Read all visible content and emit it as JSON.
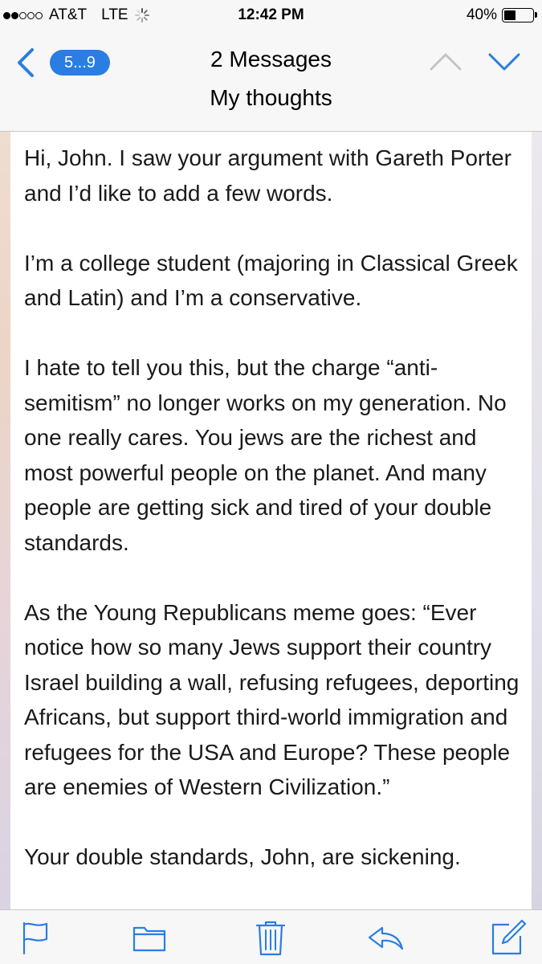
{
  "status_bar": {
    "carrier": "AT&T",
    "network": "LTE",
    "time": "12:42 PM",
    "battery_percent": "40%",
    "battery_level": 0.4,
    "signal_bars_filled": 2,
    "signal_bars_total": 5
  },
  "header": {
    "back_badge": "5...9",
    "title": "2 Messages",
    "subtitle": "My thoughts",
    "icons": {
      "back": "chevron-left-icon",
      "previous": "chevron-up-icon",
      "next": "chevron-down-icon"
    }
  },
  "message": {
    "paragraphs": [
      "Hi, John.  I saw your argument with Gareth Porter and I’d like to add a few words.",
      "I’m a college student (majoring in Classical Greek and Latin) and I’m a conservative.",
      "I hate to tell you this, but the charge “anti-semitism” no longer works on my generation.  No one really cares.  You jews are the richest and most powerful people on the planet.  And many people are getting sick and tired of your double standards.",
      "As the Young Republicans meme goes: “Ever notice how so many Jews support their country Israel building a wall, refusing refugees, deporting Africans, but support third-world immigration and refugees for the USA and Europe?  These people are enemies of Western Civilization.”",
      "Your double standards, John, are sickening."
    ]
  },
  "toolbar": {
    "icons": [
      "flag-icon",
      "folder-icon",
      "trash-icon",
      "reply-icon",
      "compose-icon"
    ]
  },
  "colors": {
    "accent": "#2a7de1",
    "bar_background": "#f7f7f7",
    "text": "#1a1a1a"
  }
}
